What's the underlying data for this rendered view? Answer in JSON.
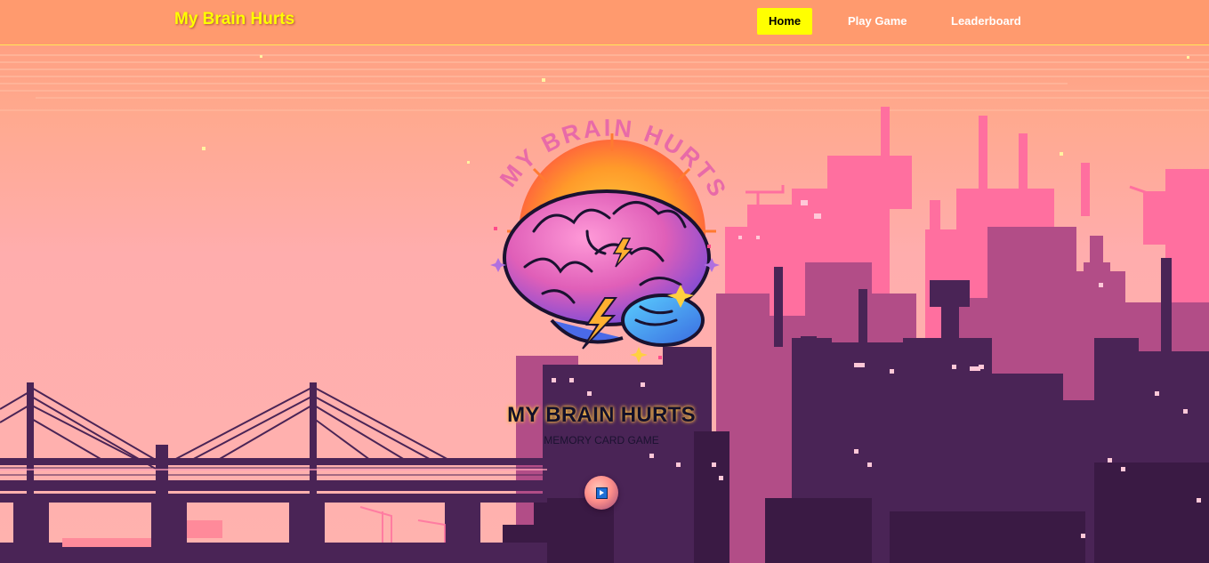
{
  "nav": {
    "brand": "My Brain Hurts",
    "links": [
      {
        "label": "Home",
        "active": true
      },
      {
        "label": "Play Game",
        "active": false
      },
      {
        "label": "Leaderboard",
        "active": false
      }
    ]
  },
  "hero": {
    "logo_text": "MY BRAIN HURTS",
    "title": "MY BRAIN HURTS",
    "subtitle": "MEMORY CARD GAME",
    "play_icon": "play-icon"
  },
  "colors": {
    "navbar": "#ff9a6e",
    "brand": "#ffff00",
    "active_nav_bg": "#ffff00",
    "sky": "#ffadad",
    "city_near": "#4a2456",
    "city_mid": "#b24d87",
    "city_far": "#ff6f9f"
  }
}
